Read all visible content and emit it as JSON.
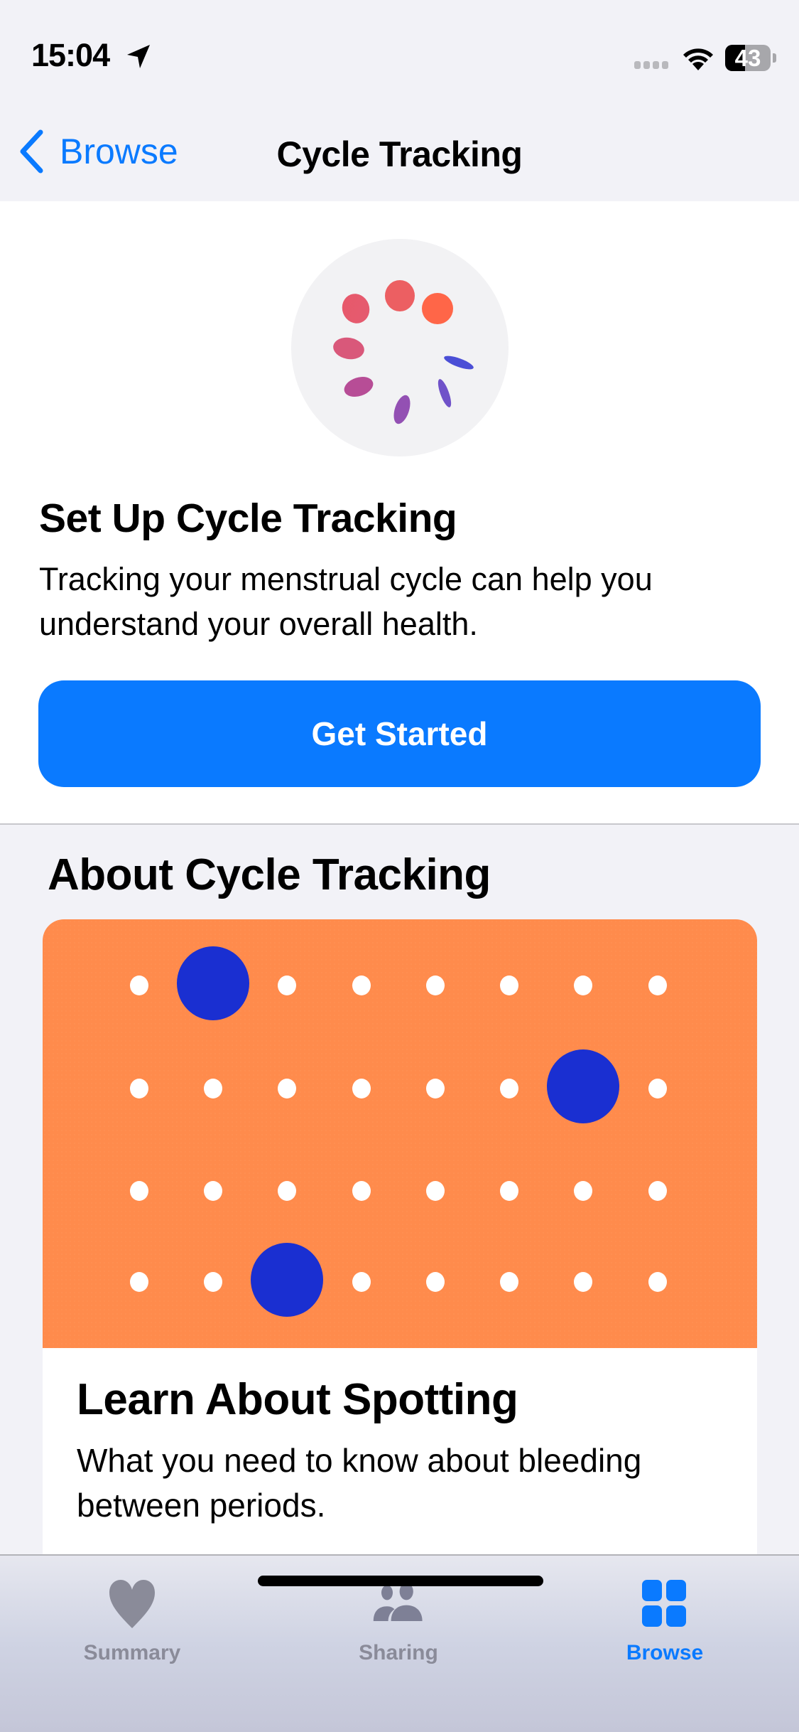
{
  "status_bar": {
    "time": "15:04",
    "location_icon": "location-arrow-icon",
    "signal_icon": "cellular-signal-icon",
    "wifi_icon": "wifi-icon",
    "battery_percent": "43",
    "battery_level": 0.43
  },
  "nav": {
    "back_label": "Browse",
    "back_icon": "chevron-left-icon",
    "title": "Cycle Tracking"
  },
  "setup": {
    "icon": "cycle-tracking-icon",
    "title": "Set Up Cycle Tracking",
    "description": "Tracking your menstrual cycle can help you understand your overall health.",
    "button_label": "Get Started"
  },
  "about": {
    "section_title": "About Cycle Tracking",
    "article": {
      "image": "dot-calendar-illustration",
      "title": "Learn About Spotting",
      "description": "What you need to know about bleeding between periods."
    }
  },
  "tab_bar": {
    "tabs": [
      {
        "label": "Summary",
        "icon": "heart-icon",
        "active": false
      },
      {
        "label": "Sharing",
        "icon": "people-icon",
        "active": false
      },
      {
        "label": "Browse",
        "icon": "grid-icon",
        "active": true
      }
    ]
  },
  "colors": {
    "accent": "#0a7aff",
    "background": "#f2f2f7",
    "illustration_orange": "#ff8b4c",
    "illustration_blue": "#1a2fd1",
    "inactive_tab": "#8a8b99"
  }
}
